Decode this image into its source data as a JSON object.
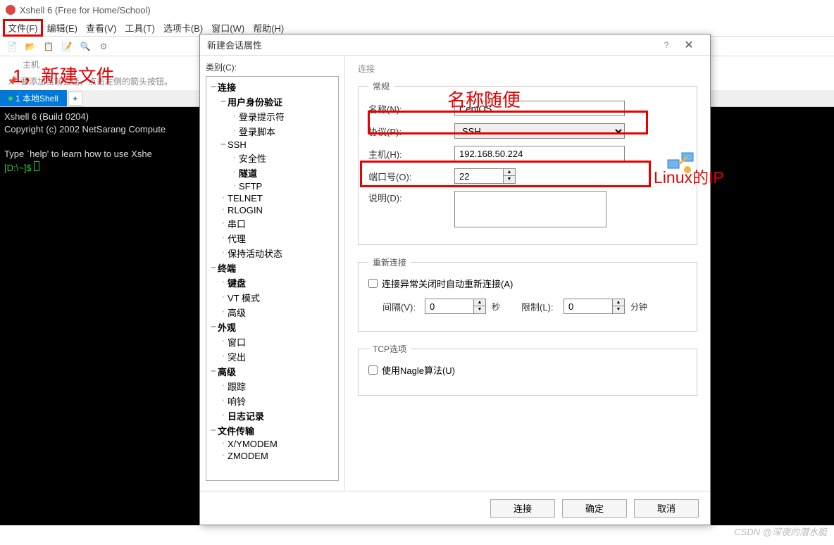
{
  "window": {
    "title": "Xshell 6 (Free for Home/School)"
  },
  "menu": [
    "文件(F)",
    "编辑(E)",
    "查看(V)",
    "工具(T)",
    "选项卡(B)",
    "窗口(W)",
    "帮助(H)"
  ],
  "annotation1": "1，新建文件",
  "toolbar_host_label": "主机",
  "hint": "要添加当前会话，点击左侧的箭头按钮。",
  "tab": {
    "label": "1 本地Shell",
    "add": "+"
  },
  "terminal": {
    "l1": "Xshell 6 (Build 0204)",
    "l2": "Copyright (c) 2002 NetSarang Compute",
    "l3": "Type `help' to learn how to use Xshe",
    "prompt": "[D:\\~]$ "
  },
  "dialog": {
    "title": "新建会话属性",
    "category_label": "类别(C):",
    "tree": [
      {
        "t": "连接",
        "d": 0,
        "tw": "−",
        "b": 1
      },
      {
        "t": "用户身份验证",
        "d": 1,
        "tw": "−",
        "b": 1
      },
      {
        "t": "登录提示符",
        "d": 2,
        "tw": "",
        "b": 0
      },
      {
        "t": "登录脚本",
        "d": 2,
        "tw": "",
        "b": 0
      },
      {
        "t": "SSH",
        "d": 1,
        "tw": "−",
        "b": 0
      },
      {
        "t": "安全性",
        "d": 2,
        "tw": "",
        "b": 0
      },
      {
        "t": "隧道",
        "d": 2,
        "tw": "",
        "b": 1
      },
      {
        "t": "SFTP",
        "d": 2,
        "tw": "",
        "b": 0
      },
      {
        "t": "TELNET",
        "d": 1,
        "tw": "",
        "b": 0
      },
      {
        "t": "RLOGIN",
        "d": 1,
        "tw": "",
        "b": 0
      },
      {
        "t": "串口",
        "d": 1,
        "tw": "",
        "b": 0
      },
      {
        "t": "代理",
        "d": 1,
        "tw": "",
        "b": 0
      },
      {
        "t": "保持活动状态",
        "d": 1,
        "tw": "",
        "b": 0
      },
      {
        "t": "终端",
        "d": 0,
        "tw": "−",
        "b": 1
      },
      {
        "t": "键盘",
        "d": 1,
        "tw": "",
        "b": 1
      },
      {
        "t": "VT 模式",
        "d": 1,
        "tw": "",
        "b": 0
      },
      {
        "t": "高级",
        "d": 1,
        "tw": "",
        "b": 0
      },
      {
        "t": "外观",
        "d": 0,
        "tw": "−",
        "b": 1
      },
      {
        "t": "窗口",
        "d": 1,
        "tw": "",
        "b": 0
      },
      {
        "t": "突出",
        "d": 1,
        "tw": "",
        "b": 0
      },
      {
        "t": "高级",
        "d": 0,
        "tw": "−",
        "b": 1
      },
      {
        "t": "跟踪",
        "d": 1,
        "tw": "",
        "b": 0
      },
      {
        "t": "响铃",
        "d": 1,
        "tw": "",
        "b": 0
      },
      {
        "t": "日志记录",
        "d": 1,
        "tw": "",
        "b": 1
      },
      {
        "t": "文件传输",
        "d": 0,
        "tw": "−",
        "b": 1
      },
      {
        "t": "X/YMODEM",
        "d": 1,
        "tw": "",
        "b": 0
      },
      {
        "t": "ZMODEM",
        "d": 1,
        "tw": "",
        "b": 0
      }
    ],
    "section": "连接",
    "group1": "常规",
    "labels": {
      "name": "名称(N):",
      "proto": "协议(P):",
      "host": "主机(H):",
      "port": "端口号(O):",
      "desc": "说明(D):",
      "reconn_chk": "连接异常关闭时自动重新连接(A)",
      "interval": "间隔(V):",
      "sec": "秒",
      "limit": "限制(L):",
      "min": "分钟",
      "nagle": "使用Nagle算法(U)"
    },
    "group2": "重新连接",
    "group3": "TCP选项",
    "vals": {
      "name": "CentOS",
      "proto": "SSH",
      "host": "192.168.50.224",
      "port": "22",
      "interval": "0",
      "limit": "0"
    },
    "buttons": {
      "connect": "连接",
      "ok": "确定",
      "cancel": "取消"
    }
  },
  "ann2": "名称随便",
  "ann3": "Linux的IP",
  "watermark": "CSDN @深夜的潜水艇"
}
